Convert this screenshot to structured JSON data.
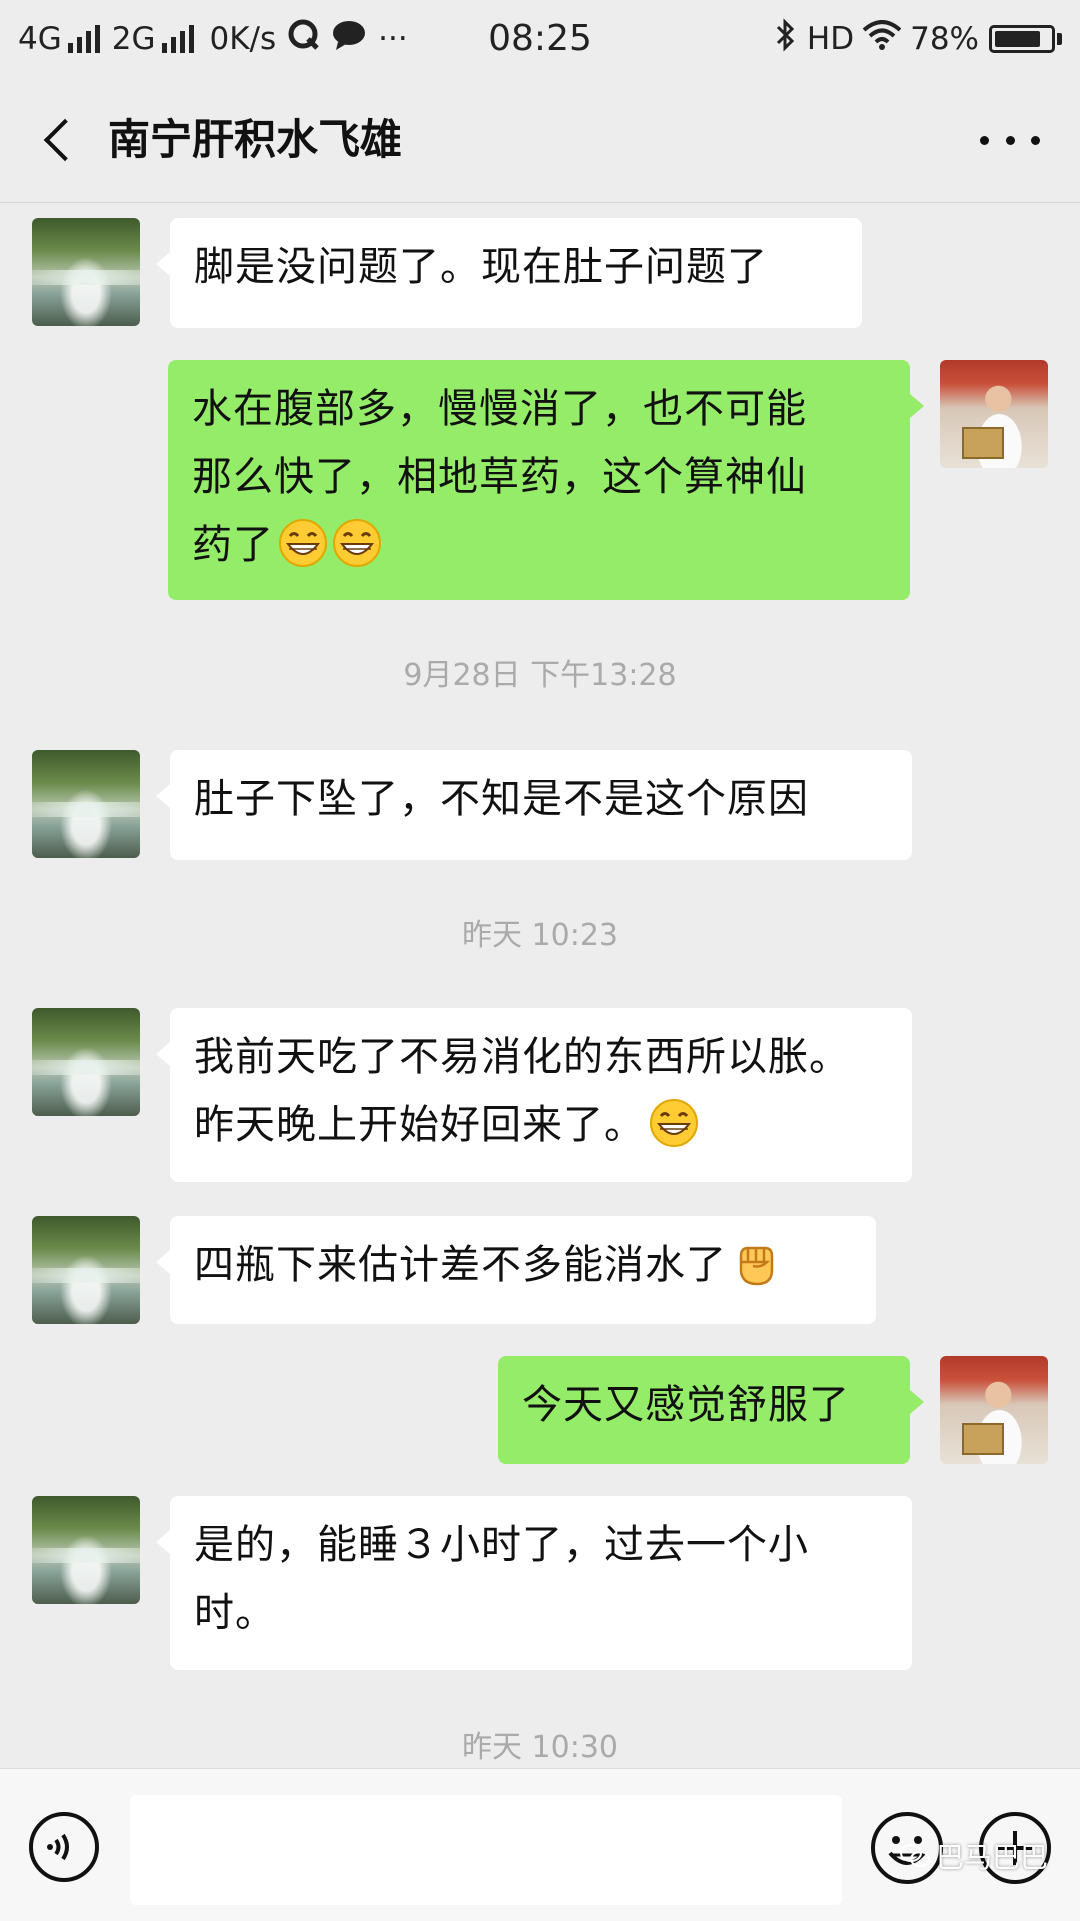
{
  "status_bar": {
    "network1": "4G",
    "network2": "2G",
    "speed": "0K/s",
    "more": "···",
    "time": "08:25",
    "hd": "HD",
    "battery": "78%",
    "icons": [
      "signal-icon",
      "message-app-icon",
      "chat-bubble-icon",
      "bluetooth-icon",
      "wifi-icon",
      "battery-icon"
    ]
  },
  "header": {
    "title": "南宁肝积水飞雄",
    "back_icon": "back-chevron-icon",
    "more_icon": "more-dots-icon"
  },
  "messages": [
    {
      "sender": "contact",
      "text": "脚是没问题了。现在肚子问题了"
    },
    {
      "sender": "self",
      "lines": [
        "水在腹部多，慢慢消了，也不可能",
        "那么快了，相地草药，这个算神仙",
        "药了"
      ],
      "emojis": [
        "grin-emoji",
        "grin-emoji"
      ]
    },
    {
      "type": "timestamp",
      "text": "9月28日 下午13:28"
    },
    {
      "sender": "contact",
      "text": "肚子下坠了，不知是不是这个原因"
    },
    {
      "type": "timestamp",
      "text": "昨天 10:23"
    },
    {
      "sender": "contact",
      "lines": [
        "我前天吃了不易消化的东西所以胀。",
        "昨天晚上开始好回来了。"
      ],
      "emojis": [
        "grin-emoji"
      ]
    },
    {
      "sender": "contact",
      "text": "四瓶下来估计差不多能消水了",
      "emojis": [
        "fist-emoji"
      ]
    },
    {
      "sender": "self",
      "text": "今天又感觉舒服了"
    },
    {
      "sender": "contact",
      "lines": [
        "是的，能睡３小时了，过去一个小",
        "时。"
      ]
    },
    {
      "type": "timestamp",
      "text": "昨天 10:30"
    }
  ],
  "input_bar": {
    "value": "",
    "voice_icon": "voice-icon",
    "emoji_icon": "emoji-face-icon",
    "plus_icon": "plus-icon"
  },
  "watermark": {
    "text": "巴马巴巴",
    "icon": "wechat-icon"
  },
  "colors": {
    "background": "#ededed",
    "bubble_self": "#95ec69",
    "bubble_contact": "#ffffff",
    "timestamp": "#aaaaaa"
  }
}
